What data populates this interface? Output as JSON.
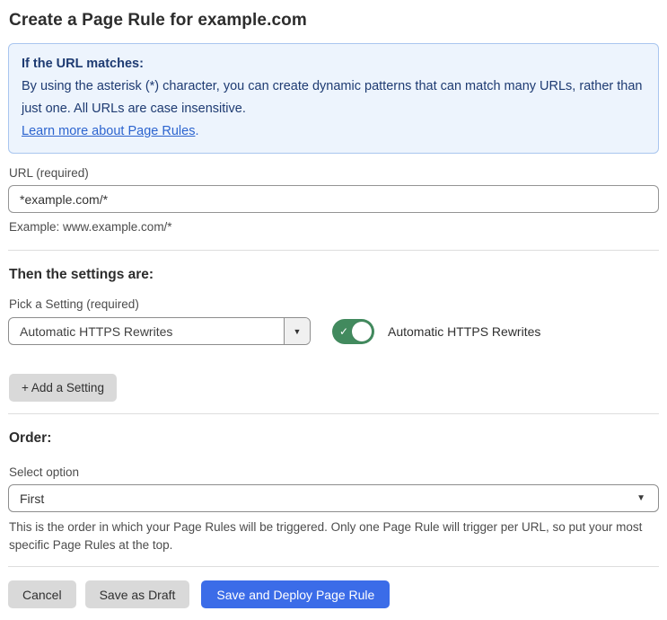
{
  "page": {
    "title": "Create a Page Rule for example.com"
  },
  "info_box": {
    "heading": "If the URL matches:",
    "body": "By using the asterisk (*) character, you can create dynamic patterns that can match many URLs, rather than just one. All URLs are case insensitive.",
    "link_label": "Learn more about Page Rules",
    "link_suffix": "."
  },
  "url_field": {
    "label": "URL (required)",
    "value": "*example.com/*",
    "example": "Example: www.example.com/*"
  },
  "settings_section": {
    "heading": "Then the settings are:",
    "picker_label": "Pick a Setting (required)",
    "picker_value": "Automatic HTTPS Rewrites",
    "toggle_state": "on",
    "toggle_label": "Automatic HTTPS Rewrites",
    "add_button_label": "+ Add a Setting"
  },
  "order_section": {
    "heading": "Order:",
    "select_label": "Select option",
    "select_value": "First",
    "help_text": "This is the order in which your Page Rules will be triggered. Only one Page Rule will trigger per URL, so put your most specific Page Rules at the top."
  },
  "footer": {
    "cancel_label": "Cancel",
    "save_draft_label": "Save as Draft",
    "save_deploy_label": "Save and Deploy Page Rule"
  },
  "icons": {
    "dropdown_arrow": "▼",
    "select_arrow": "▼",
    "toggle_check": "✓"
  },
  "colors": {
    "info_bg": "#edf4fd",
    "info_border": "#a9c6ef",
    "info_text": "#1e3b72",
    "link_blue": "#2c64cf",
    "toggle_green": "#428a5e",
    "primary_button_blue": "#3b6ce8",
    "gray_button": "#d9d9d9",
    "divider": "#dedede"
  }
}
